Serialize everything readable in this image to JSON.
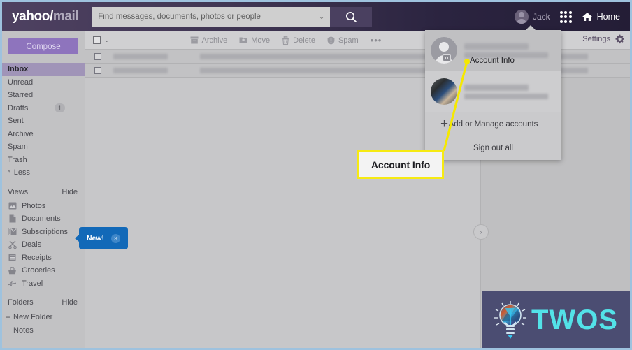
{
  "header": {
    "logo_brand": "yahoo",
    "logo_slash": "/",
    "logo_product": "mail",
    "search_placeholder": "Find messages, documents, photos or people",
    "search_value": "",
    "search_caret": "⌄",
    "account_name": "Jack",
    "home_label": "Home"
  },
  "sidebar": {
    "compose_label": "Compose",
    "items": [
      {
        "label": "Inbox",
        "active": true,
        "badge": ""
      },
      {
        "label": "Unread",
        "active": false,
        "badge": ""
      },
      {
        "label": "Starred",
        "active": false,
        "badge": ""
      },
      {
        "label": "Drafts",
        "active": false,
        "badge": "1"
      },
      {
        "label": "Sent",
        "active": false,
        "badge": ""
      },
      {
        "label": "Archive",
        "active": false,
        "badge": ""
      },
      {
        "label": "Spam",
        "active": false,
        "badge": ""
      },
      {
        "label": "Trash",
        "active": false,
        "badge": ""
      }
    ],
    "less_label": "Less",
    "views_header": "Views",
    "views_hide": "Hide",
    "views": [
      {
        "label": "Photos",
        "icon": "photos-icon"
      },
      {
        "label": "Documents",
        "icon": "document-icon"
      },
      {
        "label": "Subscriptions",
        "icon": "subscriptions-icon"
      },
      {
        "label": "Deals",
        "icon": "scissors-icon"
      },
      {
        "label": "Receipts",
        "icon": "receipt-icon"
      },
      {
        "label": "Groceries",
        "icon": "basket-icon"
      },
      {
        "label": "Travel",
        "icon": "airplane-icon"
      }
    ],
    "folders_header": "Folders",
    "folders_hide": "Hide",
    "new_folder_label": "New Folder",
    "new_folder_plus": "+",
    "folders": [
      {
        "label": "Notes"
      }
    ]
  },
  "new_bubble": {
    "label": "New!",
    "close": "×",
    "color": "#1269b8"
  },
  "toolbar": {
    "archive_label": "Archive",
    "move_label": "Move",
    "delete_label": "Delete",
    "spam_label": "Spam",
    "more_label": "•••",
    "settings_label": "Settings",
    "select_caret": "⌄"
  },
  "mail_list": {
    "rows": [
      {
        "from": "",
        "subject": "",
        "redacted": true
      },
      {
        "from": "",
        "subject": "",
        "redacted": true
      }
    ],
    "expand_caret": "›"
  },
  "dropdown": {
    "primary_account": {
      "name": "",
      "email": "",
      "redacted": true
    },
    "secondary_account": {
      "name": "",
      "email": "",
      "redacted": true
    },
    "add_manage_label": "Add or Manage accounts",
    "add_manage_plus": "+",
    "sign_out_label": "Sign out all",
    "account_info_label": "Account Info"
  },
  "annotation": {
    "callout_text": "Account Info",
    "highlight_color": "#f6ea12",
    "line_color": "#f5e800"
  },
  "watermark": {
    "text": "TWOS",
    "text_color": "#53e2e8",
    "bg_color": "#4b4d72"
  }
}
